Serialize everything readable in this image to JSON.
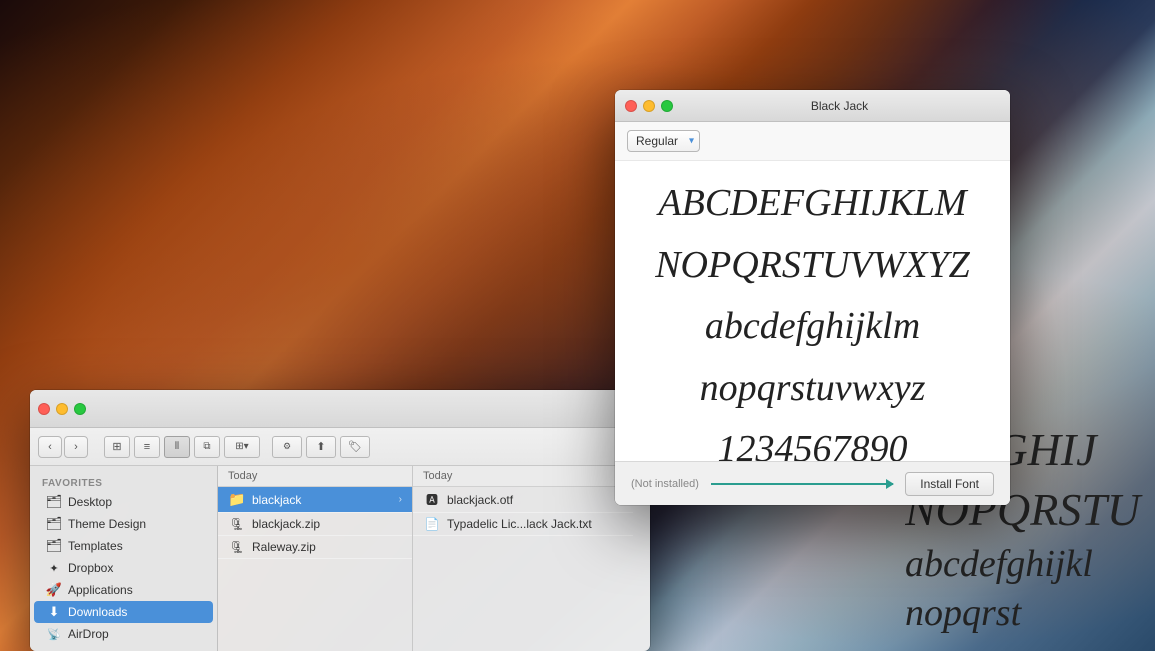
{
  "desktop": {
    "bg_colors": [
      "#1a0a0a",
      "#c4602a",
      "#2a4a6a"
    ]
  },
  "finder": {
    "traffic_lights": {
      "close": "●",
      "minimize": "●",
      "maximize": "●"
    },
    "toolbar": {
      "back": "‹",
      "forward": "›"
    },
    "sidebar": {
      "section_label": "Favorites",
      "items": [
        {
          "id": "desktop",
          "label": "Desktop",
          "icon": "🗂"
        },
        {
          "id": "theme-design",
          "label": "Theme Design",
          "icon": "🗂"
        },
        {
          "id": "templates",
          "label": "Templates",
          "icon": "🗂"
        },
        {
          "id": "dropbox",
          "label": "Dropbox",
          "icon": "📦"
        },
        {
          "id": "applications",
          "label": "Applications",
          "icon": "🚀"
        },
        {
          "id": "downloads",
          "label": "Downloads",
          "icon": "⬇"
        },
        {
          "id": "airdrop",
          "label": "AirDrop",
          "icon": "📡"
        }
      ]
    },
    "columns": [
      {
        "header": "Today",
        "items": [
          {
            "id": "blackjack-folder",
            "label": "blackjack",
            "type": "folder",
            "selected": true
          },
          {
            "id": "blackjack-zip",
            "label": "blackjack.zip",
            "type": "zip"
          },
          {
            "id": "raleway-zip",
            "label": "Raleway.zip",
            "type": "zip"
          }
        ]
      },
      {
        "header": "Today",
        "items": [
          {
            "id": "blackjack-otf",
            "label": "blackjack.otf",
            "type": "font",
            "selected": false
          },
          {
            "id": "typadelic-lic",
            "label": "Typadelic Lic...lack Jack.txt",
            "type": "text"
          }
        ]
      }
    ]
  },
  "font_window": {
    "title": "Black Jack",
    "style_label": "Regular",
    "style_options": [
      "Regular"
    ],
    "preview_lines": [
      {
        "text": "ABCDEFGHIJKLM",
        "size": 36
      },
      {
        "text": "NOPQRSTUVWXYZ",
        "size": 36
      },
      {
        "text": "abcdefghijklm",
        "size": 36
      },
      {
        "text": "nopqrstuvwxyz",
        "size": 36
      },
      {
        "text": "1234567890",
        "size": 36
      }
    ],
    "bottom_bar": {
      "not_installed": "(Not installed)",
      "install_label": "Install Font"
    }
  },
  "bg_font_preview": {
    "lines": [
      "DEFGHIJ",
      "NOPQRSTU",
      "abcdefghijkl",
      "nopqrst"
    ]
  }
}
